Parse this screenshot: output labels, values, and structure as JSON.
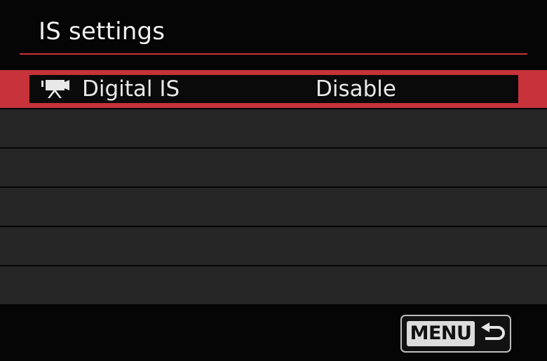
{
  "header": {
    "title": "IS settings"
  },
  "menu": {
    "items": [
      {
        "icon": "movie-camera-icon",
        "label": "Digital IS",
        "value": "Disable",
        "selected": true
      }
    ],
    "empty_rows": 5
  },
  "footer": {
    "menu_button_label": "MENU",
    "menu_button_icon": "return-arrow-icon"
  },
  "colors": {
    "accent": "#c8323a",
    "row_background": "#262626",
    "screen_background": "#050505"
  }
}
